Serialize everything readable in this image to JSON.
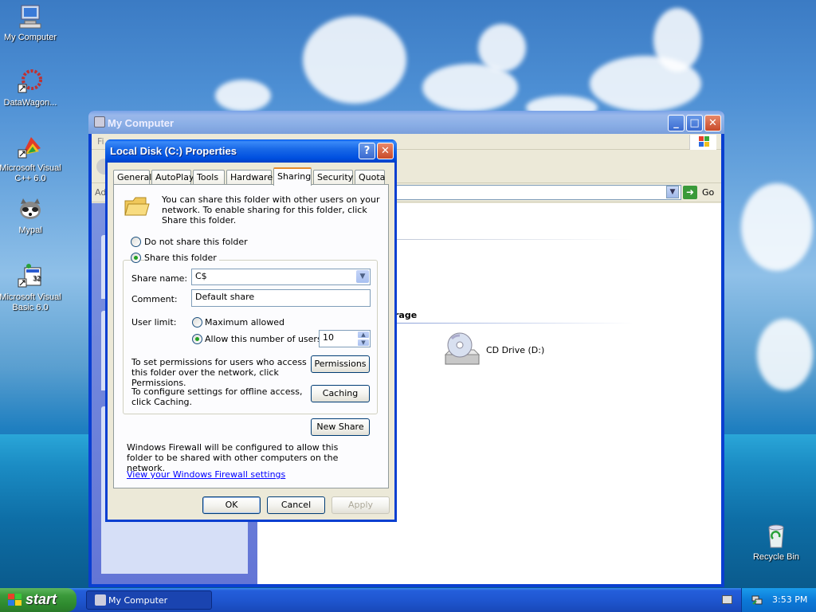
{
  "desktop": {
    "icons": [
      {
        "label": "My Computer",
        "icon": "computer-icon"
      },
      {
        "label": "DataWagon...",
        "icon": "datawagon-icon"
      },
      {
        "label": "Microsoft Visual C++ 6.0",
        "icon": "vcpp-icon"
      },
      {
        "label": "Mypal",
        "icon": "mypal-icon"
      },
      {
        "label": "Microsoft Visual Basic 6.0",
        "icon": "vb-icon"
      },
      {
        "label": "Recycle Bin",
        "icon": "recycle-bin-icon"
      }
    ]
  },
  "explorer": {
    "title": "My Computer",
    "menu_first": "Fi",
    "address_label": "Ad",
    "go_label": "Go",
    "group_label": "rage",
    "cd_drive_label": "CD Drive (D:)"
  },
  "dialog": {
    "title": "Local Disk (C:) Properties",
    "tabs": [
      "General",
      "AutoPlay",
      "Tools",
      "Hardware",
      "Sharing",
      "Security",
      "Quota"
    ],
    "selected_tab": "Sharing",
    "intro": "You can share this folder with other users on your network.  To enable sharing for this folder, click Share this folder.",
    "radio_no_share": "Do not share this folder",
    "radio_share": "Share this folder",
    "share_name_label": "Share name:",
    "share_name_value": "C$",
    "comment_label": "Comment:",
    "comment_value": "Default share",
    "user_limit_label": "User limit:",
    "max_allowed": "Maximum allowed",
    "allow_users": "Allow this number of users:",
    "user_count": "10",
    "permissions_text": "To set permissions for users who access this folder over the network, click Permissions.",
    "permissions_button": "Permissions",
    "caching_text": "To configure settings for offline access, click Caching.",
    "caching_button": "Caching",
    "new_share_button": "New Share",
    "firewall_text": "Windows Firewall will be configured to allow this folder to be shared with other computers on the network.",
    "firewall_link": "View your Windows Firewall settings",
    "ok": "OK",
    "cancel": "Cancel",
    "apply": "Apply"
  },
  "taskbar": {
    "start": "start",
    "task_label": "My Computer",
    "clock": "3:53 PM"
  }
}
